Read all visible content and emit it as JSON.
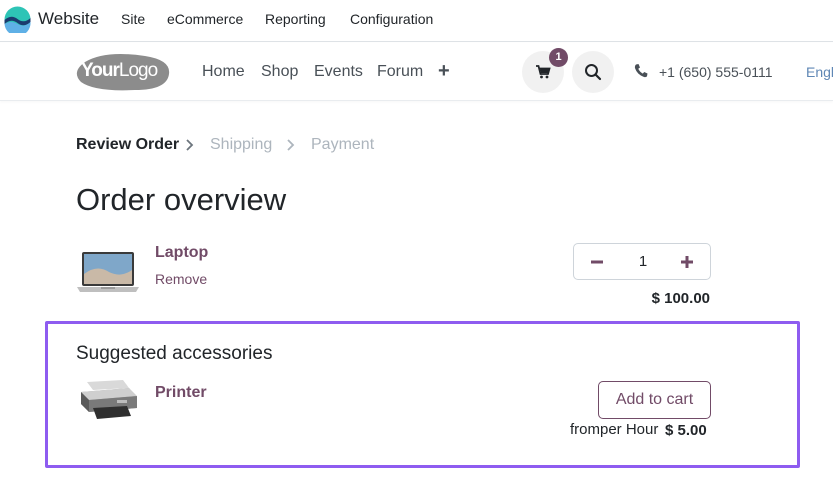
{
  "backend_bar": {
    "app_name": "Website",
    "menus": [
      "Site",
      "eCommerce",
      "Reporting",
      "Configuration"
    ]
  },
  "header": {
    "logo_bold": "Your",
    "logo_light": "Logo",
    "nav": [
      "Home",
      "Shop",
      "Events",
      "Forum"
    ],
    "cart_count": "1",
    "phone": "+1 (650) 555-0111",
    "language": "Engl"
  },
  "checkout_steps": {
    "current": "Review Order",
    "next": "Shipping",
    "last": "Payment"
  },
  "page_title": "Order overview",
  "order_line": {
    "product": "Laptop",
    "remove_label": "Remove",
    "quantity": "1",
    "price": "$ 100.00"
  },
  "accessories": {
    "title": "Suggested accessories",
    "product": "Printer",
    "add_label": "Add to cart",
    "from_label": "fromper Hour",
    "price": "$ 5.00"
  },
  "colors": {
    "brand": "#714b67",
    "highlight_border": "#8e5cf0"
  },
  "icons": [
    "app-logo-icon",
    "plus-icon",
    "cart-icon",
    "search-icon",
    "phone-icon",
    "chevron-right-icon",
    "minus-icon",
    "laptop-image",
    "printer-image"
  ]
}
